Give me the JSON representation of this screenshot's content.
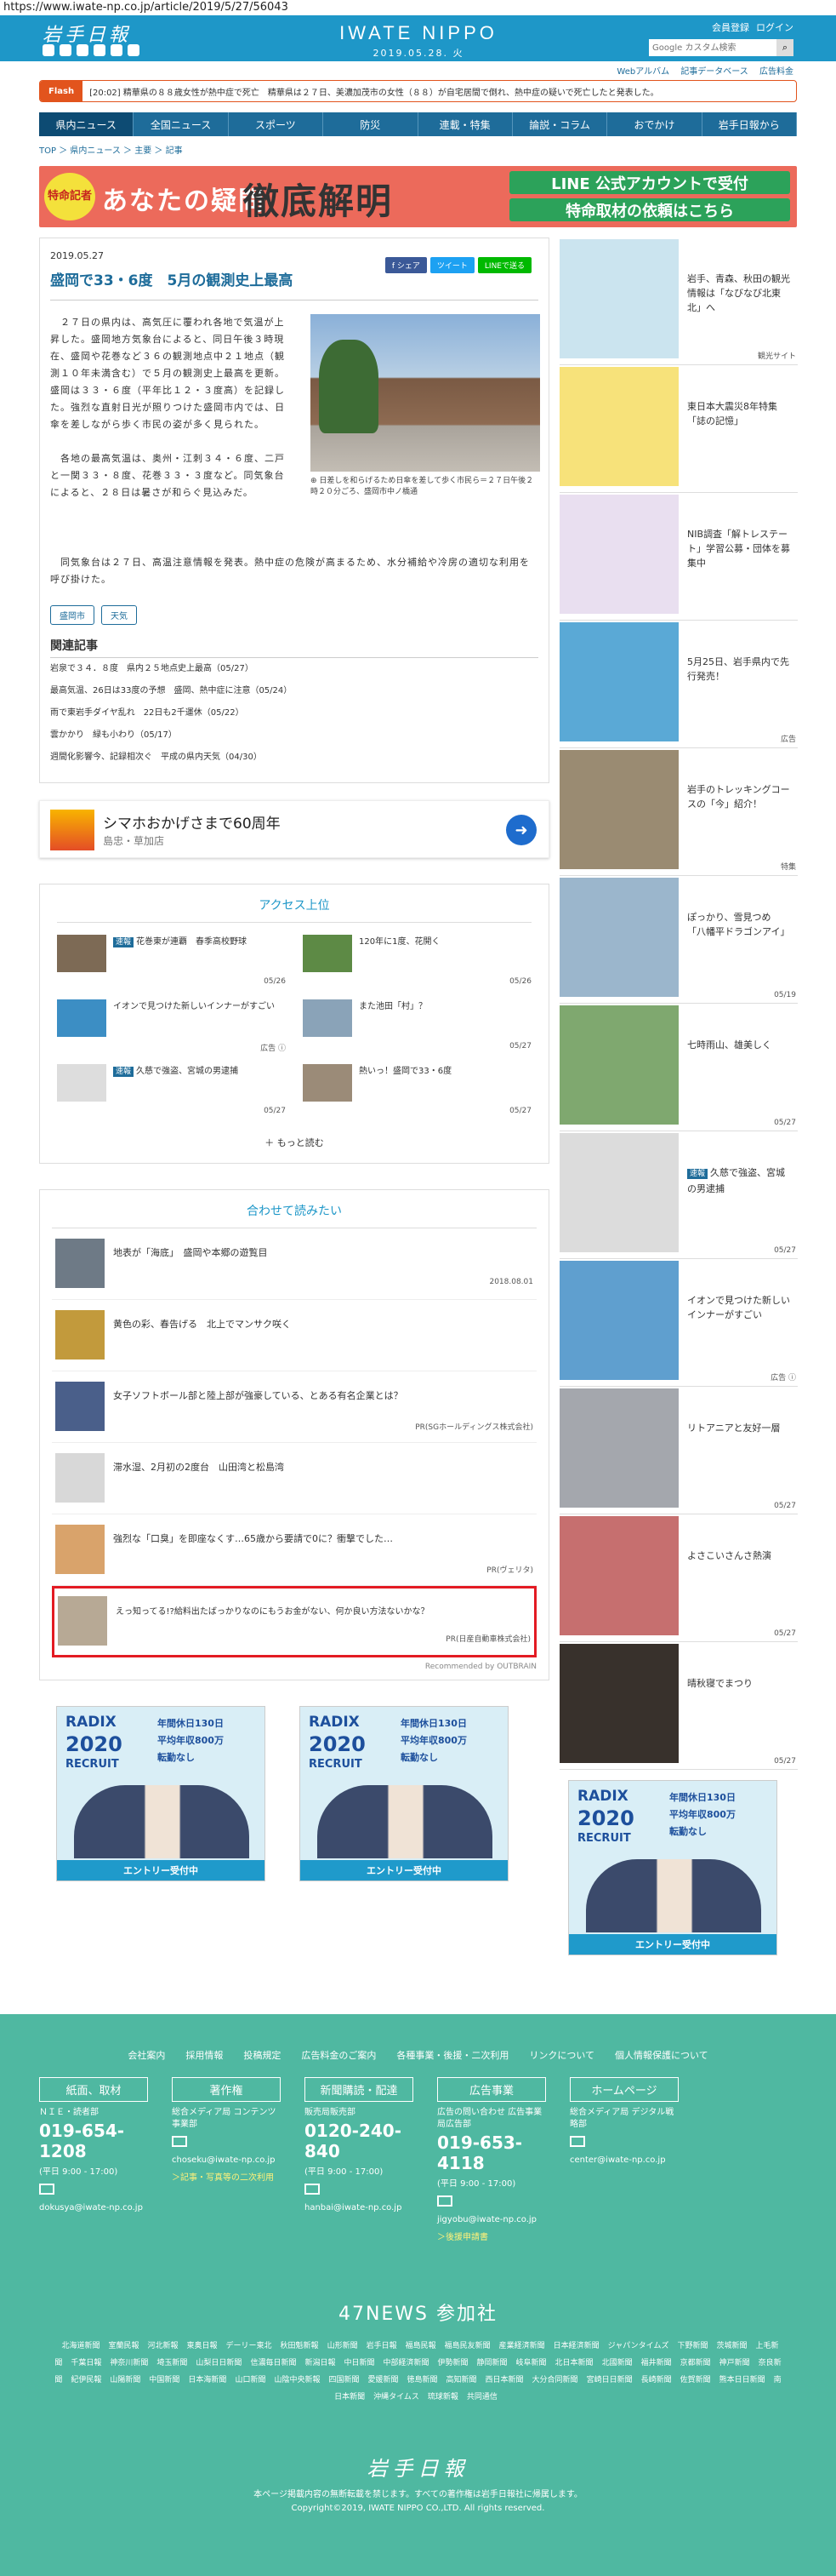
{
  "url": "https://www.iwate-np.co.jp/article/2019/5/27/56043",
  "header": {
    "logo": "岩手日報",
    "brand": "IWATE NIPPO",
    "date": "2019.05.28. 火",
    "links": [
      "会員登録",
      "ログイン"
    ],
    "search_placeholder": "Google カスタム検索",
    "subnav": [
      "Webアルバム",
      "記事データベース",
      "広告料金"
    ]
  },
  "flash": {
    "tag": "Flash",
    "text": "[20:02]  精華県の８８歳女性が熱中症で死亡　精華県は２７日、美濃加茂市の女性（８８）が自宅居間で倒れ、熱中症の疑いで死亡したと発表した。"
  },
  "nav": [
    "県内ニュース",
    "全国ニュース",
    "スポーツ",
    "防災",
    "連載・特集",
    "論説・コラム",
    "おでかけ",
    "岩手日報から"
  ],
  "breadcrumb": "TOP ＞ 県内ニュース ＞ 主要 ＞ 記事",
  "banner": {
    "badge": "特命記者",
    "q": "あなたの疑問",
    "main": "徹底解明",
    "line1": "LINE 公式アカウントで受付",
    "line2": "特命取材の依頼はこちら"
  },
  "article": {
    "date": "2019.05.27",
    "share": [
      "f シェア",
      "ツイート",
      "LINEで送る"
    ],
    "title": "盛岡で33・6度　5月の観測史上最高",
    "lead": "　２７日の県内は、高気圧に覆われ各地で気温が上昇した。盛岡地方気象台によると、同日午後３時現在、盛岡や花巻など３６の観測地点中２１地点（観測１０年未満含む）で５月の観測史上最高を更新。盛岡は３３・６度（平年比１２・３度高）を記録した。強烈な直射日光が照りつけた盛岡市内では、日傘を差しながら歩く市民の姿が多く見られた。",
    "lead2": "　各地の最高気温は、奥州・江刺３４・６度、二戸と一関３３・８度、花巻３３・３度など。同気象台によると、２８日は暑さが和らぐ見込みだ。",
    "more": "　同気象台は２７日、高温注意情報を発表。熱中症の危険が高まるため、水分補給や冷房の適切な利用を呼び掛けた。",
    "caption": "日差しを和らげるため日傘を差して歩く市民ら＝２７日午後２時２０分ごろ、盛岡市中ノ橋通",
    "tags": [
      "盛岡市",
      "天気"
    ],
    "related_title": "関連記事",
    "related": [
      "岩泉で３４．８度　県内２５地点史上最高（05/27）",
      "最高気温、26日は33度の予想　盛岡、熱中症に注意（05/24）",
      "雨で東岩手ダイヤ乱れ　22日も2千運休（05/22）",
      "雲かかり　緑も小わり（05/17）",
      "週間化影響今、記録相次ぐ　平成の県内天気（04/30）"
    ]
  },
  "ad": {
    "title": "シマホおかげさまで60周年",
    "sub": "島忠・草加店"
  },
  "ranking": {
    "title": "アクセス上位",
    "items": [
      {
        "badge": "速報",
        "text": "花巻東が連覇　春季高校野球",
        "date": "05/26"
      },
      {
        "badge": "",
        "text": "120年に1度、花開く",
        "date": "05/26"
      },
      {
        "badge": "",
        "text": "イオンで見つけた新しいインナーがすごい",
        "date": "広告 ⓘ"
      },
      {
        "badge": "",
        "text": "また池田「村」？",
        "date": "05/27"
      },
      {
        "badge": "速報",
        "text": "久慈で強盗、宮城の男逮捕",
        "date": "05/27"
      },
      {
        "badge": "",
        "text": "熱いっ！盛岡で33・6度",
        "date": "05/27"
      }
    ],
    "more": "もっと読む"
  },
  "recommend": {
    "title": "合わせて読みたい",
    "items": [
      {
        "text": "地表が「海底」　盛岡や本郷の遊覧目",
        "sub": "2018.08.01"
      },
      {
        "text": "黄色の彩、春告げる　北上でマンサク咲く",
        "sub": ""
      },
      {
        "text": "女子ソフトボール部と陸上部が強豪している、とある有名企業とは？",
        "sub": "PR(SGホールディングス株式会社)"
      },
      {
        "text": "滞水湿、2月初の2度台　山田湾と松島湾",
        "sub": ""
      },
      {
        "text": "強烈な「口臭」を即座なくす…65歳から要請で0に？衝撃でした…",
        "sub": "PR(ヴェリタ)"
      },
      {
        "text": "えっ知ってる!?給料出たばっかりなのにもうお金がない、何か良い方法ないかな？",
        "sub": "PR(日産自動車株式会社)"
      }
    ],
    "powered": "Recommended by OUTBRAIN"
  },
  "radix": {
    "logo": "RADIX",
    "year": "2020",
    "recruit": "RECRUIT",
    "points": [
      "年間休日130日",
      "平均年収800万",
      "転勤なし"
    ],
    "entry": "エントリー受付中"
  },
  "sidebar": [
    {
      "text": "岩手、青森、秋田の観光情報は「なびなび北東北」へ",
      "src": "観光サイト",
      "badge": "",
      "color": "#cbe4ef"
    },
    {
      "text": "東日本大震災8年特集「誌の記憶」",
      "src": "",
      "badge": "",
      "color": "#f7e27a"
    },
    {
      "text": "NIB調査「解トレステート」学習公募・団体を募集中",
      "src": "",
      "badge": "",
      "color": "#e9dff0"
    },
    {
      "text": "5月25日、岩手県内で先行発売！",
      "src": "広告",
      "badge": "",
      "color": "#5aa9d6"
    },
    {
      "text": "岩手のトレッキングコースの「今」紹介！",
      "src": "特集",
      "badge": "",
      "color": "#9a8b72"
    },
    {
      "text": "ぽっかり、雪見つめ　「八幡平ドラゴンアイ」",
      "src": "05/19",
      "badge": "",
      "color": "#9bb6cc"
    },
    {
      "text": "七時雨山、雄美しく",
      "src": "05/27",
      "badge": "",
      "color": "#7fa86f"
    },
    {
      "text": "久慈で強盗、宮城の男逮捕",
      "src": "05/27",
      "badge": "速報",
      "color": "#dcdcdc"
    },
    {
      "text": "イオンで見つけた新しいインナーがすごい",
      "src": "広告 ⓘ",
      "badge": "",
      "color": "#5f9fcf"
    },
    {
      "text": "リトアニアと友好一層",
      "src": "05/27",
      "badge": "",
      "color": "#a4a7ad"
    },
    {
      "text": "よさこいさんさ熱演",
      "src": "05/27",
      "badge": "",
      "color": "#c66f6f"
    },
    {
      "text": "晴秋寝でまつり",
      "src": "05/27",
      "badge": "",
      "color": "#38312c"
    }
  ],
  "footer": {
    "links": [
      "会社案内",
      "採用情報",
      "投稿規定",
      "広告料金のご案内",
      "各種事業・後援・二次利用",
      "リンクについて",
      "個人情報保護について"
    ],
    "cols": [
      {
        "hd": "紙面、取材",
        "l1": "ＮＩＥ・読者部",
        "tel": "019-654-1208",
        "hours": "(平日 9:00 - 17:00)",
        "mail": "dokusya@iwate-np.co.jp",
        "y": ""
      },
      {
        "hd": "著作権",
        "l1": "総合メディア局 コンテンツ事業部",
        "tel": "",
        "hours": "",
        "mail": "choseku@iwate-np.co.jp",
        "y": "＞記事・写真等の二次利用"
      },
      {
        "hd": "新聞購読・配達",
        "l1": "販売局販売部",
        "tel": "0120-240-840",
        "hours": "(平日 9:00 - 17:00)",
        "mail": "hanbai@iwate-np.co.jp",
        "y": ""
      },
      {
        "hd": "広告事業",
        "l1": "広告の問い合わせ 広告事業局広告部",
        "tel": "019-653-4118",
        "hours": "(平日 9:00 - 17:00)",
        "mail": "jigyobu@iwate-np.co.jp",
        "y": "＞後援申請書"
      },
      {
        "hd": "ホームページ",
        "l1": "総合メディア局 デジタル戦略部",
        "tel": "",
        "hours": "",
        "mail": "center@iwate-np.co.jp",
        "y": ""
      }
    ],
    "n47": "47NEWS 参加社",
    "papers": [
      "北海道新聞",
      "室蘭民報",
      "河北新報",
      "東奥日報",
      "デーリー東北",
      "秋田魁新報",
      "山形新聞",
      "岩手日報",
      "福島民報",
      "福島民友新聞",
      "産業経済新聞",
      "日本経済新聞",
      "ジャパンタイムズ",
      "下野新聞",
      "茨城新聞",
      "上毛新聞",
      "千葉日報",
      "神奈川新聞",
      "埼玉新聞",
      "山梨日日新聞",
      "信濃毎日新聞",
      "新潟日報",
      "中日新聞",
      "中部経済新聞",
      "伊勢新聞",
      "静岡新聞",
      "岐阜新聞",
      "北日本新聞",
      "北國新聞",
      "福井新聞",
      "京都新聞",
      "神戸新聞",
      "奈良新聞",
      "紀伊民報",
      "山陽新聞",
      "中国新聞",
      "日本海新聞",
      "山口新聞",
      "山陰中央新報",
      "四国新聞",
      "愛媛新聞",
      "徳島新聞",
      "高知新聞",
      "西日本新聞",
      "大分合同新聞",
      "宮崎日日新聞",
      "長崎新聞",
      "佐賀新聞",
      "熊本日日新聞",
      "南日本新聞",
      "沖縄タイムス",
      "琉球新報",
      "共同通信"
    ],
    "logo": "岩手日報",
    "copy1": "本ページ掲載内容の無断転載を禁じます。すべての著作権は岩手日報社に帰属します。",
    "copy2": "Copyright©2019, IWATE NIPPO CO.,LTD. All rights reserved."
  }
}
